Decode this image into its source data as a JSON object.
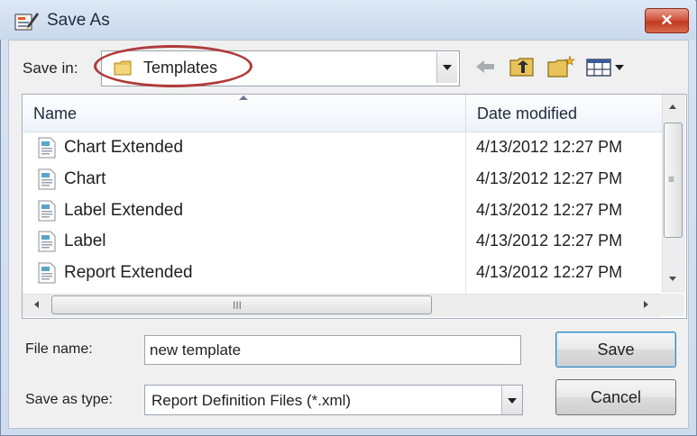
{
  "window": {
    "title": "Save As",
    "close_label": "✕"
  },
  "save_in": {
    "label": "Save in:",
    "value": "Templates"
  },
  "toolbar": {
    "icons": [
      "back-arrow-icon",
      "up-folder-icon",
      "new-folder-icon",
      "view-menu-icon"
    ]
  },
  "file_list": {
    "columns": [
      "Name",
      "Date modified"
    ],
    "rows": [
      {
        "name": "Chart Extended",
        "date": "4/13/2012 12:27 PM"
      },
      {
        "name": "Chart",
        "date": "4/13/2012 12:27 PM"
      },
      {
        "name": "Label Extended",
        "date": "4/13/2012 12:27 PM"
      },
      {
        "name": "Label",
        "date": "4/13/2012 12:27 PM"
      },
      {
        "name": "Report Extended",
        "date": "4/13/2012 12:27 PM"
      }
    ],
    "hscroll_grip": "III",
    "vscroll_grip": "≡"
  },
  "file_name": {
    "label": "File name:",
    "value": "new template"
  },
  "save_as_type": {
    "label": "Save as type:",
    "value": "Report Definition Files (*.xml)"
  },
  "buttons": {
    "save": "Save",
    "cancel": "Cancel"
  },
  "colors": {
    "annotation": "#b03a3a",
    "close_button": "#c23a20"
  }
}
